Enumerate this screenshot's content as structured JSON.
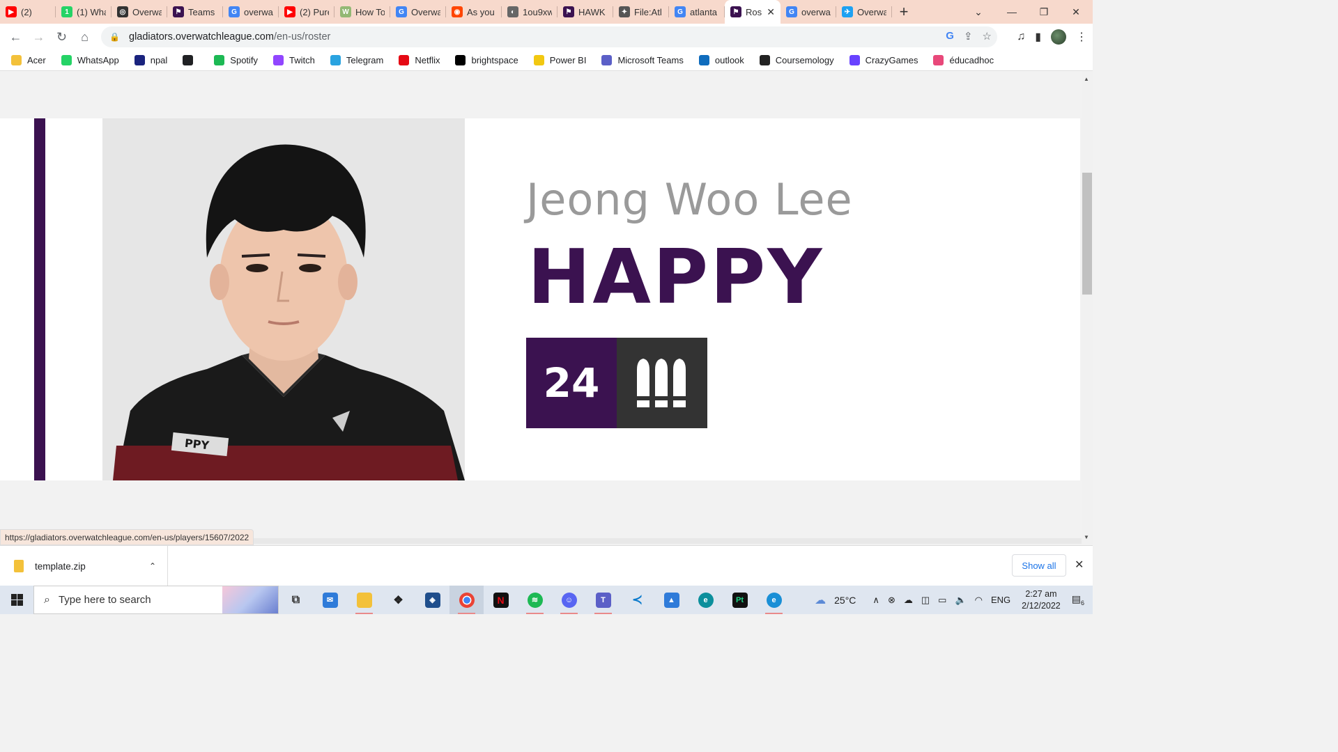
{
  "tabs": [
    {
      "title": "(2)",
      "icon": "youtube-icon",
      "color": "#ff0000",
      "glyph": "▶"
    },
    {
      "title": "(1) Wha",
      "icon": "whatsapp-icon",
      "color": "#25d366",
      "glyph": "1"
    },
    {
      "title": "Overwa",
      "icon": "overwatch-icon",
      "color": "#333333",
      "glyph": "◎"
    },
    {
      "title": "Teams",
      "icon": "gladiators-icon",
      "color": "#3b1250",
      "glyph": "⚑"
    },
    {
      "title": "overwa",
      "icon": "google-icon",
      "color": "#4285f4",
      "glyph": "G"
    },
    {
      "title": "(2) Pure",
      "icon": "youtube-icon",
      "color": "#ff0000",
      "glyph": "▶"
    },
    {
      "title": "How To",
      "icon": "wikihow-icon",
      "color": "#93b874",
      "glyph": "W"
    },
    {
      "title": "Overwa",
      "icon": "google-icon",
      "color": "#4285f4",
      "glyph": "G"
    },
    {
      "title": "As you",
      "icon": "reddit-icon",
      "color": "#ff4500",
      "glyph": "◉"
    },
    {
      "title": "1ou9xw",
      "icon": "globe-icon",
      "color": "#666666",
      "glyph": "◐"
    },
    {
      "title": "HAWK",
      "icon": "gladiators-icon",
      "color": "#3b1250",
      "glyph": "⚑"
    },
    {
      "title": "File:Atl",
      "icon": "wiki-icon",
      "color": "#555555",
      "glyph": "✦"
    },
    {
      "title": "atlanta",
      "icon": "google-icon",
      "color": "#4285f4",
      "glyph": "G"
    },
    {
      "title": "Ros",
      "icon": "gladiators-icon",
      "color": "#3b1250",
      "glyph": "⚑",
      "active": true
    },
    {
      "title": "overwa",
      "icon": "google-icon",
      "color": "#4285f4",
      "glyph": "G"
    },
    {
      "title": "Overwa",
      "icon": "twitter-icon",
      "color": "#1da1f2",
      "glyph": "✈"
    }
  ],
  "address": {
    "host": "gladiators.overwatchleague.com",
    "path": "/en-us/roster"
  },
  "bookmarks": [
    {
      "label": "Acer",
      "icon": "folder-icon",
      "color": "#f3c13a"
    },
    {
      "label": "WhatsApp",
      "icon": "whatsapp-icon",
      "color": "#25d366"
    },
    {
      "label": "npal",
      "icon": "npal-icon",
      "color": "#1a237e"
    },
    {
      "label": "",
      "icon": "globe-icon",
      "color": "#202124"
    },
    {
      "label": "Spotify",
      "icon": "spotify-icon",
      "color": "#1db954"
    },
    {
      "label": "Twitch",
      "icon": "twitch-icon",
      "color": "#9146ff"
    },
    {
      "label": "Telegram",
      "icon": "telegram-icon",
      "color": "#2aa3e0"
    },
    {
      "label": "Netflix",
      "icon": "netflix-icon",
      "color": "#e50914"
    },
    {
      "label": "brightspace",
      "icon": "np-icon",
      "color": "#000000"
    },
    {
      "label": "Power BI",
      "icon": "powerbi-icon",
      "color": "#f2c811"
    },
    {
      "label": "Microsoft Teams",
      "icon": "teams-icon",
      "color": "#5b5fc7"
    },
    {
      "label": "outlook",
      "icon": "outlook-icon",
      "color": "#0f6cbd"
    },
    {
      "label": "Coursemology",
      "icon": "coursemology-icon",
      "color": "#222222"
    },
    {
      "label": "CrazyGames",
      "icon": "crazygames-icon",
      "color": "#6842ff"
    },
    {
      "label": "éducadhoc",
      "icon": "educadhoc-icon",
      "color": "#e8487a"
    }
  ],
  "player": {
    "real_name": "Jeong Woo Lee",
    "handle": "HAPPY",
    "number": "24",
    "role_icon": "damage-role-icon",
    "jersey_text": "PPY",
    "accent_color": "#3b1250"
  },
  "status_url": "https://gladiators.overwatchleague.com/en-us/players/15607/2022",
  "downloads": {
    "file": "template.zip",
    "show_all": "Show all"
  },
  "taskbar": {
    "search_placeholder": "Type here to search",
    "weather": "25°C",
    "language": "ENG",
    "time": "2:27 am",
    "date": "2/12/2022",
    "notifications": "6"
  }
}
